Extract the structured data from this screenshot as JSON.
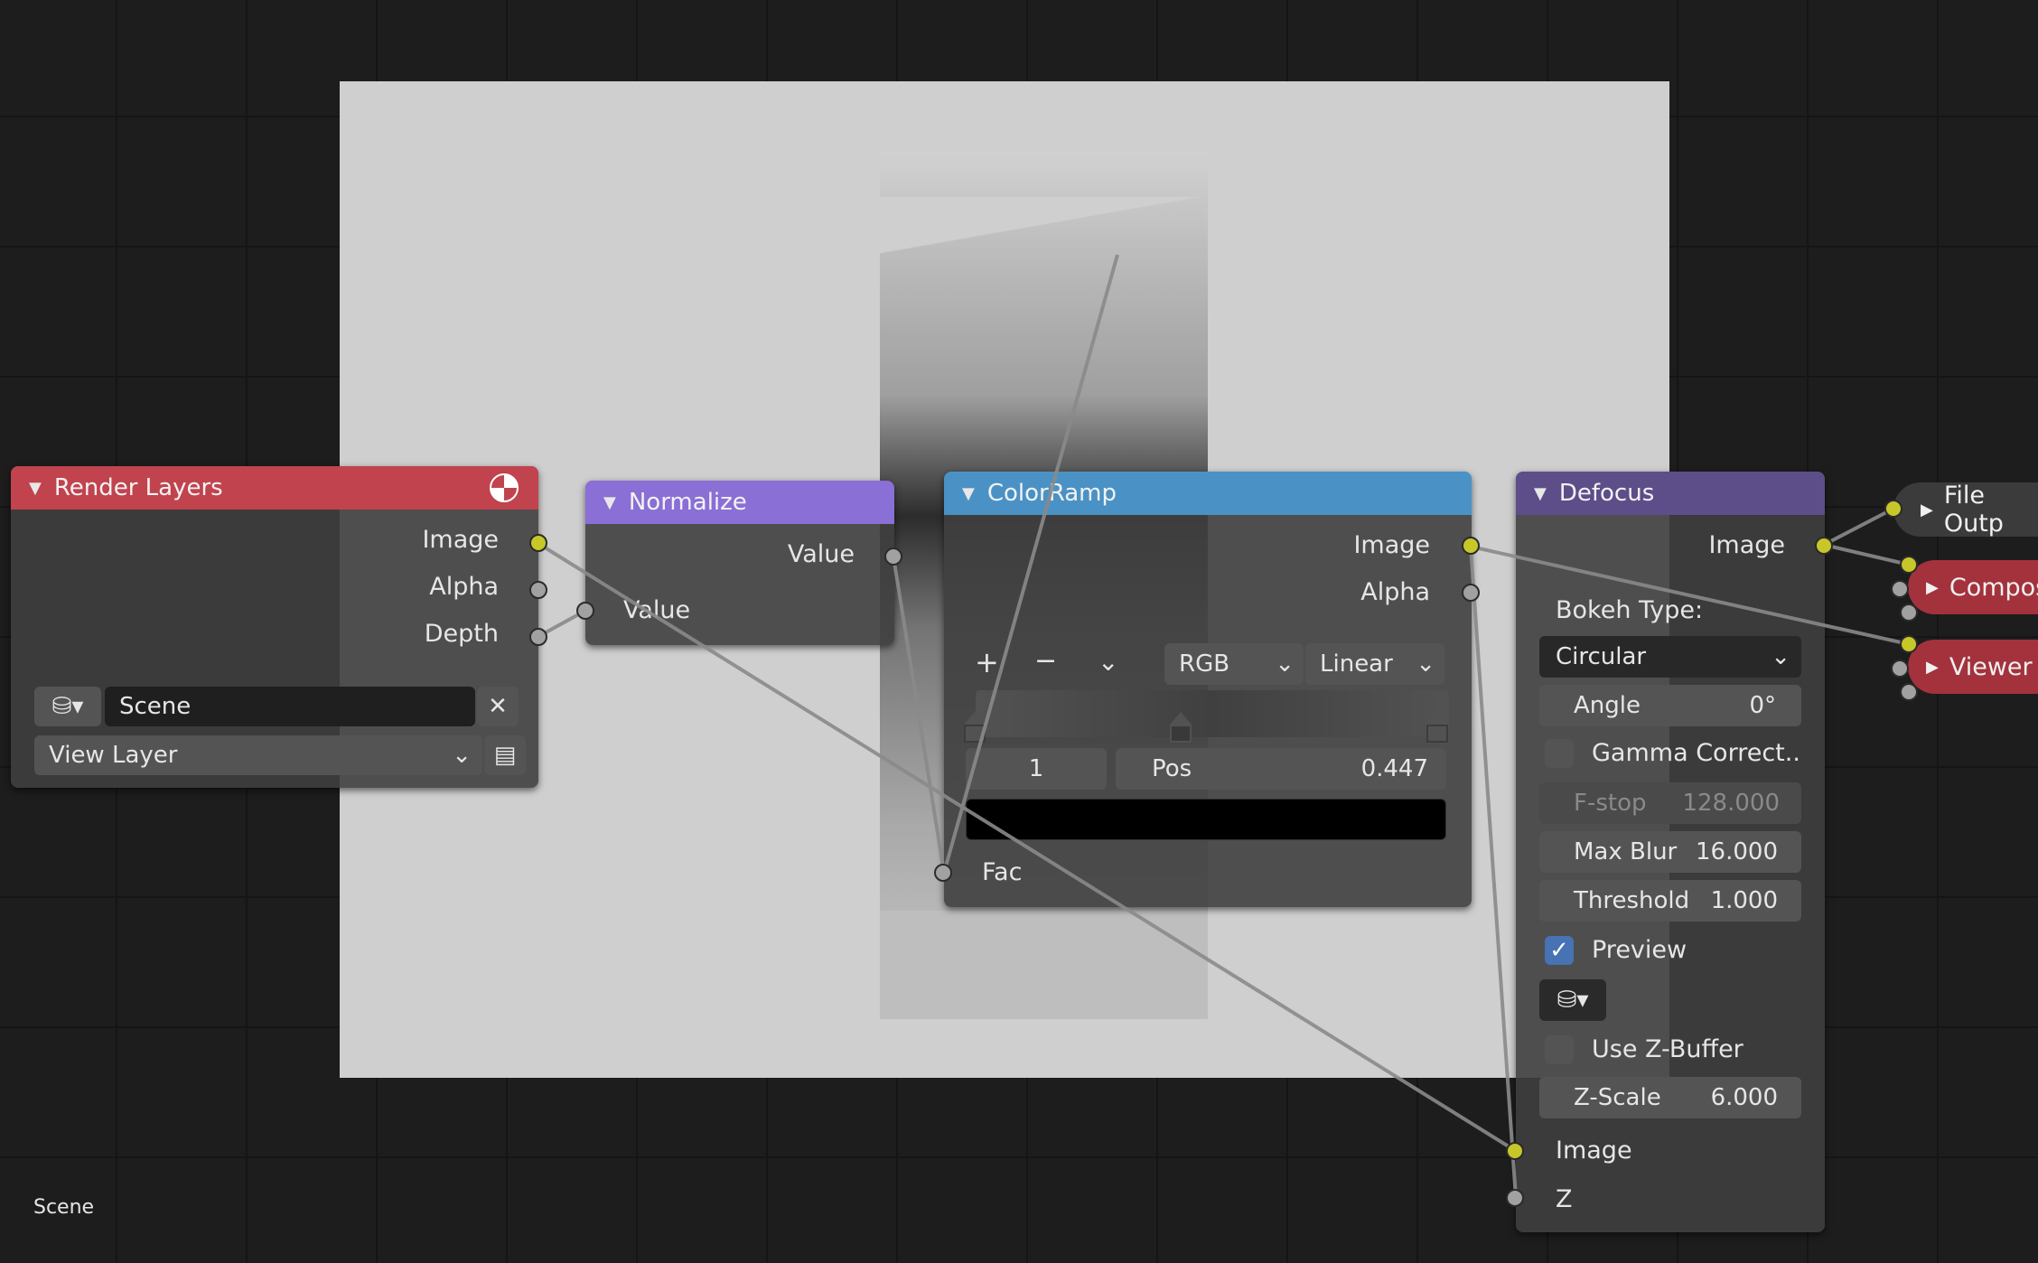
{
  "status_label": "Scene",
  "render_layers": {
    "title": "Render Layers",
    "outputs": [
      "Image",
      "Alpha",
      "Depth"
    ],
    "scene": "Scene",
    "view_layer": "View Layer",
    "header_color": "#c1434e"
  },
  "normalize": {
    "title": "Normalize",
    "output": "Value",
    "input": "Value",
    "header_color": "#8a6fd6"
  },
  "colorramp": {
    "title": "ColorRamp",
    "outputs": [
      "Image",
      "Alpha"
    ],
    "add_icon": "+",
    "remove_icon": "−",
    "color_mode": "RGB",
    "interpolation": "Linear",
    "active_index": "1",
    "pos_label": "Pos",
    "pos_value": "0.447",
    "active_color": "#000000",
    "input": "Fac",
    "header_color": "#4a92c5"
  },
  "defocus": {
    "title": "Defocus",
    "output": "Image",
    "bokeh_type_label": "Bokeh Type:",
    "bokeh_type": "Circular",
    "angle_label": "Angle",
    "angle_value": "0°",
    "gamma_label": "Gamma Correct..",
    "fstop_label": "F-stop",
    "fstop_value": "128.000",
    "maxblur_label": "Max Blur",
    "maxblur_value": "16.000",
    "threshold_label": "Threshold",
    "threshold_value": "1.000",
    "preview_label": "Preview",
    "zbuffer_label": "Use Z-Buffer",
    "zscale_label": "Z-Scale",
    "zscale_value": "6.000",
    "inputs": [
      "Image",
      "Z"
    ],
    "header_color": "#5d4e8a"
  },
  "outputs_nodes": {
    "file_output": "File Outp",
    "composite": "Compos",
    "viewer": "Viewer",
    "file_color": "#3b3b3b",
    "composite_color": "#a3323c"
  }
}
